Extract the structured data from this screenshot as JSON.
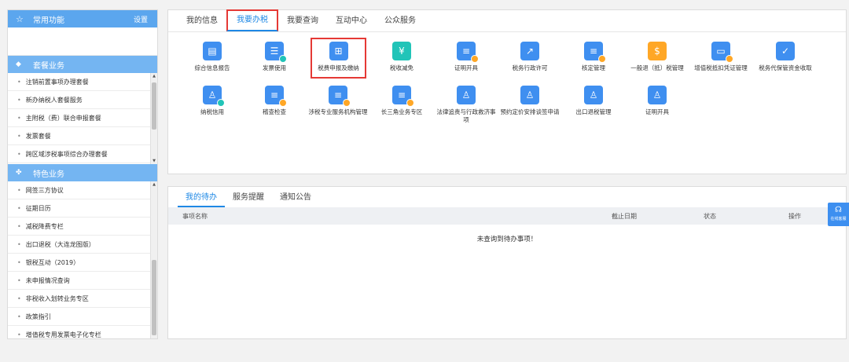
{
  "sidebar": {
    "favorites": {
      "title": "常用功能",
      "settings_label": "设置"
    },
    "package_group": {
      "title": "套餐业务",
      "items": [
        {
          "label": "注销前置事项办理套餐"
        },
        {
          "label": "新办纳税人套餐服务"
        },
        {
          "label": "主附税（费）联合申报套餐"
        },
        {
          "label": "发票套餐"
        },
        {
          "label": "跨区域涉税事项综合办理套餐"
        }
      ]
    },
    "special_group": {
      "title": "特色业务",
      "items": [
        {
          "label": "网签三方协议"
        },
        {
          "label": "征期日历"
        },
        {
          "label": "减税降费专栏"
        },
        {
          "label": "出口退税（大连龙图版）"
        },
        {
          "label": "银税互动（2019）"
        },
        {
          "label": "未申报情况查询"
        },
        {
          "label": "非税收入划转业务专区"
        },
        {
          "label": "政策指引"
        },
        {
          "label": "增值税专用发票电子化专栏"
        }
      ]
    }
  },
  "top_tabs": [
    {
      "label": "我的信息"
    },
    {
      "label": "我要办税"
    },
    {
      "label": "我要查询"
    },
    {
      "label": "互动中心"
    },
    {
      "label": "公众服务"
    }
  ],
  "tax_services": [
    {
      "label": "综合信息报告",
      "icon": "report-icon",
      "color": "#3f8ff0"
    },
    {
      "label": "发票使用",
      "icon": "invoice-icon",
      "color": "#3f8ff0"
    },
    {
      "label": "税费申报及缴纳",
      "icon": "declare-icon",
      "color": "#3f8ff0"
    },
    {
      "label": "税收减免",
      "icon": "tax-relief-icon",
      "color": "#21c4b8"
    },
    {
      "label": "证明开具",
      "icon": "certificate-icon",
      "color": "#3f8ff0"
    },
    {
      "label": "税务行政许可",
      "icon": "chart-icon",
      "color": "#3f8ff0"
    },
    {
      "label": "核定管理",
      "icon": "approval-icon",
      "color": "#3f8ff0"
    },
    {
      "label": "一般退（抵）税管理",
      "icon": "refund-icon",
      "color": "#ffa726"
    },
    {
      "label": "增值税抵扣凭证管理",
      "icon": "deduction-icon",
      "color": "#3f8ff0"
    },
    {
      "label": "税务代保管资金收取",
      "icon": "custody-icon",
      "color": "#3f8ff0"
    },
    {
      "label": "纳税信用",
      "icon": "credit-icon",
      "color": "#3f8ff0"
    },
    {
      "label": "稽查检查",
      "icon": "inspection-icon",
      "color": "#3f8ff0"
    },
    {
      "label": "涉税专业服务机构管理",
      "icon": "agency-icon",
      "color": "#3f8ff0"
    },
    {
      "label": "长三角业务专区",
      "icon": "delta-icon",
      "color": "#3f8ff0"
    },
    {
      "label": "法律追责与行政救济事项",
      "icon": "legal-icon",
      "color": "#3f8ff0"
    },
    {
      "label": "预约定价安排谈签申请",
      "icon": "pricing-icon",
      "color": "#3f8ff0"
    },
    {
      "label": "出口退税管理",
      "icon": "export-refund-icon",
      "color": "#3f8ff0"
    },
    {
      "label": "证明开具",
      "icon": "certificate-person-icon",
      "color": "#3f8ff0"
    }
  ],
  "bottom_tabs": [
    {
      "label": "我的待办"
    },
    {
      "label": "服务提醒"
    },
    {
      "label": "通知公告"
    }
  ],
  "todo_table": {
    "columns": [
      "事项名称",
      "截止日期",
      "状态",
      "操作"
    ],
    "empty_message": "未查询到待办事项！"
  },
  "float_service": {
    "label": "在线客服"
  },
  "colors": {
    "sidebar_header": "#5ba6ee",
    "accent": "#1e88e5",
    "highlight": "#e53935"
  }
}
